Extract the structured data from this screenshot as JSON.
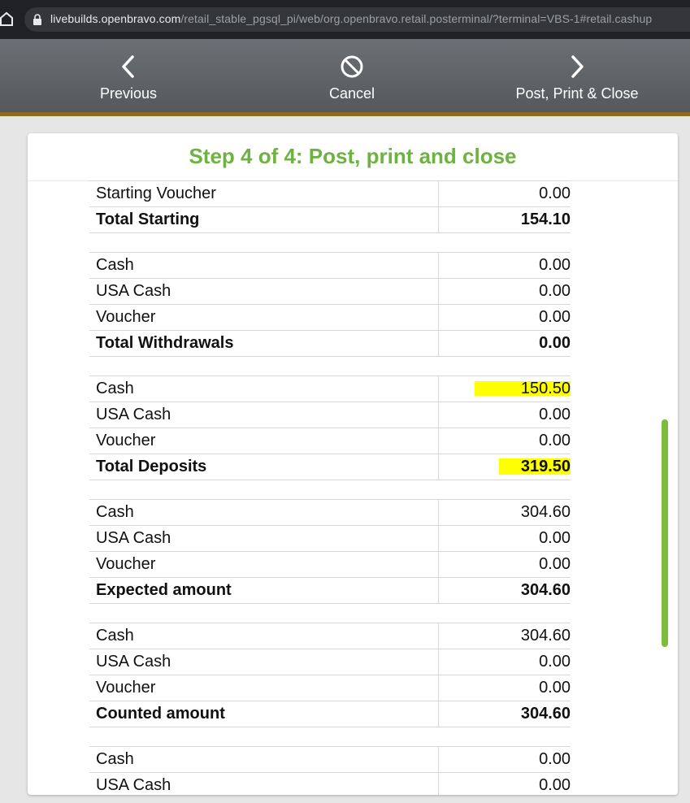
{
  "browser": {
    "url_host": "livebuilds.openbravo.com",
    "url_path": "/retail_stable_pgsql_pi/web/org.openbravo.retail.posterminal/?terminal=VBS-1#retail.cashup"
  },
  "toolbar": {
    "previous_label": "Previous",
    "cancel_label": "Cancel",
    "post_label": "Post, Print & Close"
  },
  "card": {
    "title": "Step 4 of 4: Post, print and close"
  },
  "groups": [
    {
      "rows": [
        {
          "label": "Starting Voucher",
          "value": "0.00"
        },
        {
          "label": "Total Starting",
          "value": "154.10"
        }
      ]
    },
    {
      "rows": [
        {
          "label": "Cash",
          "value": "0.00"
        },
        {
          "label": "USA Cash",
          "value": "0.00"
        },
        {
          "label": "Voucher",
          "value": "0.00"
        },
        {
          "label": "Total Withdrawals",
          "value": "0.00"
        }
      ]
    },
    {
      "rows": [
        {
          "label": "Cash",
          "value": "150.50"
        },
        {
          "label": "USA Cash",
          "value": "0.00"
        },
        {
          "label": "Voucher",
          "value": "0.00"
        },
        {
          "label": "Total Deposits",
          "value": "319.50"
        }
      ]
    },
    {
      "rows": [
        {
          "label": "Cash",
          "value": "304.60"
        },
        {
          "label": "USA Cash",
          "value": "0.00"
        },
        {
          "label": "Voucher",
          "value": "0.00"
        },
        {
          "label": "Expected amount",
          "value": "304.60"
        }
      ]
    },
    {
      "rows": [
        {
          "label": "Cash",
          "value": "304.60"
        },
        {
          "label": "USA Cash",
          "value": "0.00"
        },
        {
          "label": "Voucher",
          "value": "0.00"
        },
        {
          "label": "Counted amount",
          "value": "304.60"
        }
      ]
    },
    {
      "rows": [
        {
          "label": "Cash",
          "value": "0.00"
        },
        {
          "label": "USA Cash",
          "value": "0.00"
        }
      ]
    }
  ],
  "colors": {
    "accent": "#6db33f",
    "highlight": "#ffff00",
    "toolbar_border": "#8a6d1e"
  }
}
